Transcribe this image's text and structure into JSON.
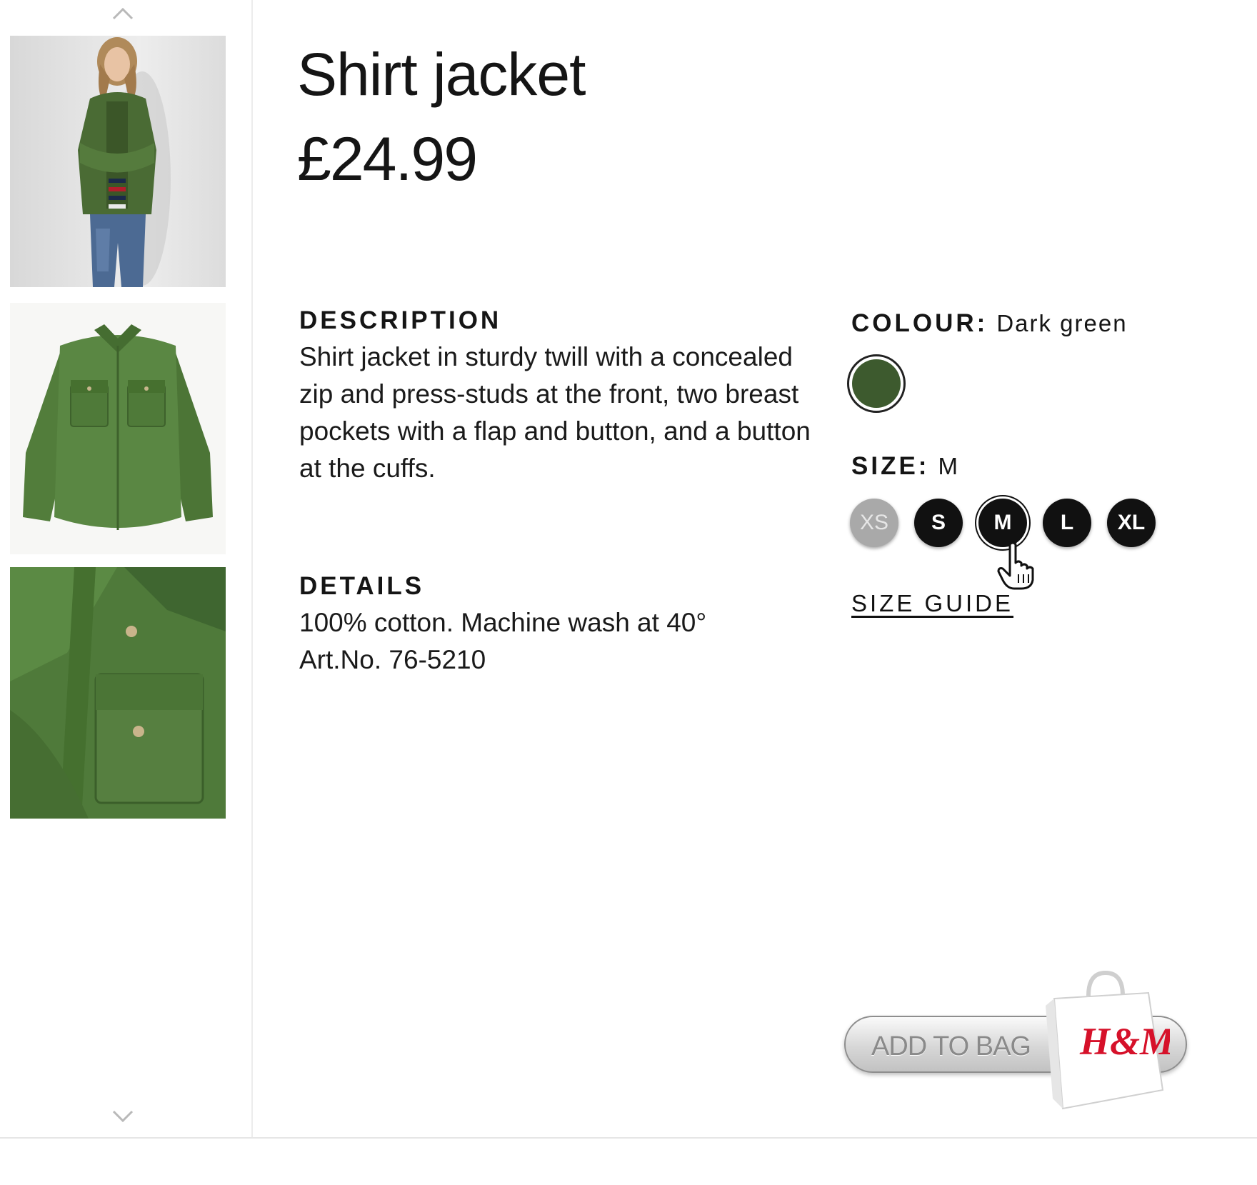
{
  "product": {
    "title": "Shirt jacket",
    "price": "£24.99"
  },
  "description": {
    "heading": "DESCRIPTION",
    "text": "Shirt jacket in sturdy twill with a concealed zip and press-studs at the front, two breast pockets with a flap and button, and a button at the cuffs."
  },
  "details": {
    "heading": "DETAILS",
    "line1": "100% cotton. Machine wash at 40°",
    "line2": "Art.No. 76-5210"
  },
  "colour": {
    "label": "COLOUR:",
    "value": "Dark green",
    "swatch_color": "#3d5a2e"
  },
  "size": {
    "label": "SIZE:",
    "value": "M",
    "options": [
      {
        "label": "XS",
        "available": false
      },
      {
        "label": "S",
        "available": true
      },
      {
        "label": "M",
        "available": true,
        "selected": true
      },
      {
        "label": "L",
        "available": true
      },
      {
        "label": "XL",
        "available": true
      }
    ],
    "guide_label": "SIZE GUIDE"
  },
  "cart": {
    "add_label": "ADD TO BAG",
    "brand_logo": "H&M"
  },
  "colors": {
    "accent_green": "#4f7a3a",
    "brand_red": "#d6112a"
  },
  "icons": [
    "chevron-up-icon",
    "chevron-down-icon",
    "hand-pointer-icon",
    "shopping-bag-icon"
  ]
}
